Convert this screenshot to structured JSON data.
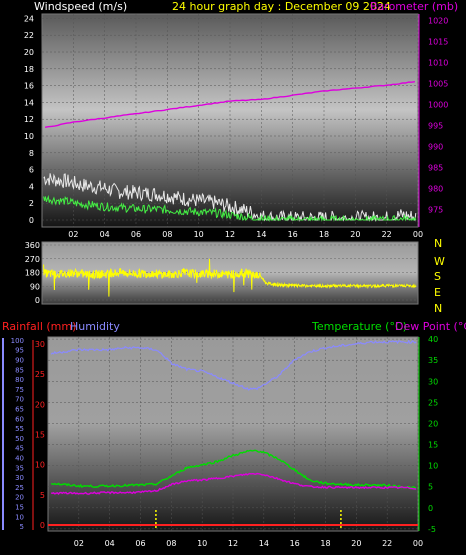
{
  "header": {
    "left_label": "Windspeed (m/s)",
    "title": "24 hour graph day : December 09 2024",
    "right_label": "Barometer (mb)"
  },
  "bottom_header": {
    "rainfall_label": "Rainfall (mm)",
    "humidity_label": "Humidity",
    "temperature_label": "Temperature (°C)",
    "dewpoint_label": "Dew Point (°C)"
  },
  "colors": {
    "background": "#000000",
    "axis_text": "#ffffff",
    "title": "#ffff00",
    "barometer": "#dd00dd",
    "gust": "#e8e8e8",
    "wind": "#44ee44",
    "direction": "#ffff00",
    "rainfall": "#ff2020",
    "humidity": "#8a8aff",
    "temperature": "#00dd00",
    "dewpoint": "#dd00dd",
    "rain_marker": "#ffff00"
  },
  "chart_data": [
    {
      "type": "line",
      "x_ticks": [
        "02",
        "04",
        "06",
        "08",
        "10",
        "12",
        "14",
        "16",
        "18",
        "20",
        "22",
        "00"
      ],
      "xlim": [
        0,
        24
      ],
      "y_left": {
        "label": "Windspeed (m/s)",
        "ticks": [
          0,
          2,
          4,
          6,
          8,
          10,
          12,
          14,
          16,
          18,
          20,
          22,
          24
        ],
        "ylim": [
          0,
          25
        ]
      },
      "y_right": {
        "label": "Barometer (mb)",
        "ticks": [
          975,
          980,
          985,
          990,
          995,
          1000,
          1005,
          1010,
          1015,
          1020
        ],
        "ylim": [
          972.5,
          1022.5
        ]
      },
      "grid": true,
      "series": [
        {
          "name": "Barometer (mb)",
          "axis": "right",
          "x": [
            0.2,
            2,
            4,
            6,
            8,
            10,
            12,
            14,
            16,
            18,
            20,
            22,
            23.9
          ],
          "values": [
            994.5,
            995.8,
            996.8,
            997.8,
            998.8,
            999.8,
            1000.8,
            1001.2,
            1002.2,
            1003.2,
            1003.9,
            1004.6,
            1005.5
          ]
        },
        {
          "axis": "left",
          "x": [
            0.1,
            0.8,
            1.6,
            2.4,
            3.2,
            4,
            4.8,
            5.6,
            6.4,
            7.2,
            8,
            8.8,
            9.6,
            10.4,
            11.2,
            12,
            12.8,
            13.4,
            14,
            15,
            16,
            18,
            20,
            22,
            23,
            23.9
          ],
          "values": [
            5.0,
            4.8,
            4.6,
            4.2,
            4.0,
            3.8,
            3.4,
            3.3,
            3.2,
            3.1,
            2.9,
            2.6,
            2.4,
            2.2,
            2.0,
            1.6,
            1.2,
            0.9,
            0.4,
            0.2,
            0.2,
            0.2,
            0.2,
            0.2,
            0.6,
            0.3
          ]
        },
        {
          "axis": "left",
          "x": [
            0.1,
            0.8,
            1.6,
            2.4,
            3.2,
            4,
            4.8,
            5.6,
            6.4,
            7.2,
            8,
            8.8,
            9.6,
            10.4,
            11.2,
            12,
            12.8,
            13.4,
            14,
            15,
            16,
            18,
            20,
            22,
            23,
            23.9
          ],
          "values": [
            2.6,
            2.4,
            2.2,
            1.9,
            1.8,
            1.6,
            1.5,
            1.4,
            1.3,
            1.3,
            1.2,
            1.1,
            1.0,
            0.9,
            0.8,
            0.6,
            0.4,
            0.2,
            0.1,
            0,
            0,
            0,
            0,
            0,
            0.1,
            0
          ]
        }
      ]
    },
    {
      "type": "line",
      "x_ticks": [
        "02",
        "04",
        "06",
        "08",
        "10",
        "12",
        "14",
        "16",
        "18",
        "20",
        "22",
        "00"
      ],
      "xlim": [
        0,
        24
      ],
      "y_left": {
        "ticks": [
          0,
          90,
          180,
          270,
          360
        ],
        "ylim": [
          0,
          360
        ]
      },
      "y_right_labels": [
        "N",
        "W",
        "S",
        "E",
        "N"
      ],
      "series": [
        {
          "name": "Wind direction",
          "x": [
            0.1,
            1,
            2,
            3,
            4,
            5,
            6,
            7,
            8,
            9,
            10,
            11,
            12,
            12.8,
            13.4,
            14,
            14.3,
            15,
            16,
            17,
            18,
            19,
            20,
            21,
            22,
            23,
            23.9
          ],
          "values": [
            175,
            170,
            178,
            165,
            170,
            180,
            172,
            175,
            165,
            178,
            170,
            172,
            168,
            175,
            170,
            150,
            110,
            100,
            95,
            92,
            90,
            94,
            92,
            90,
            95,
            92,
            93
          ]
        }
      ]
    },
    {
      "type": "line",
      "x_ticks": [
        "02",
        "04",
        "06",
        "08",
        "10",
        "12",
        "14",
        "16",
        "18",
        "20",
        "22",
        "00"
      ],
      "xlim": [
        0,
        24
      ],
      "y_left_rain": {
        "label": "Rainfall (mm)",
        "ticks": [
          0,
          5,
          10,
          15,
          20,
          25,
          30
        ],
        "ylim": [
          -0.5,
          30.5
        ]
      },
      "y_left_humidity": {
        "label": "Humidity",
        "ticks": [
          5,
          10,
          15,
          20,
          25,
          30,
          35,
          40,
          45,
          50,
          55,
          60,
          65,
          70,
          75,
          80,
          85,
          90,
          95,
          100
        ],
        "ylim": [
          2.5,
          101.5
        ]
      },
      "y_right": {
        "label": "Temperature (°C)",
        "ticks": [
          -5,
          0,
          5,
          10,
          15,
          20,
          25,
          30,
          35,
          40
        ],
        "ylim": [
          -5.5,
          40.5
        ]
      },
      "grid": true,
      "rain_markers_x": [
        7,
        19
      ],
      "series": [
        {
          "name": "Humidity",
          "axis": "humidity",
          "x": [
            0.2,
            1,
            2,
            3,
            4,
            5,
            6,
            7,
            7.5,
            8,
            9,
            10,
            11,
            12,
            13,
            13.5,
            14,
            15,
            16,
            17,
            18,
            19,
            20,
            21,
            22,
            23,
            23.9
          ],
          "values": [
            93,
            94,
            95,
            95,
            95,
            96,
            96,
            95,
            92,
            88,
            85,
            84,
            81,
            78,
            75,
            75,
            77,
            82,
            90,
            94,
            96,
            97,
            98,
            99,
            99,
            99,
            99
          ]
        },
        {
          "name": "Temperature (°C)",
          "axis": "right",
          "x": [
            0.2,
            1,
            2,
            3,
            4,
            5,
            6,
            7,
            8,
            9,
            10,
            11,
            12,
            13,
            13.5,
            14,
            15,
            16,
            17,
            18,
            19,
            20,
            21,
            22,
            23,
            23.9
          ],
          "values": [
            5.8,
            5.5,
            5.2,
            5.1,
            5.2,
            5.3,
            5.4,
            5.6,
            7.5,
            9.5,
            10.2,
            11.0,
            12.4,
            13.4,
            13.6,
            13.1,
            11.5,
            9.0,
            6.5,
            5.8,
            5.6,
            5.4,
            5.4,
            5.3,
            5.0,
            4.7
          ]
        },
        {
          "name": "Dew Point (°C)",
          "axis": "right",
          "x": [
            0.2,
            1,
            2,
            3,
            4,
            5,
            6,
            7,
            8,
            9,
            10,
            11,
            12,
            13,
            13.5,
            14,
            15,
            16,
            17,
            18,
            19,
            20,
            21,
            22,
            23,
            23.9
          ],
          "values": [
            3.4,
            3.5,
            3.4,
            3.5,
            3.6,
            3.6,
            3.7,
            4.0,
            5.5,
            6.4,
            6.6,
            7.0,
            7.5,
            8.0,
            8.1,
            7.9,
            6.8,
            5.7,
            5.0,
            4.9,
            4.8,
            4.8,
            4.8,
            4.8,
            4.8,
            4.6
          ]
        },
        {
          "name": "Rainfall (mm)",
          "axis": "rain",
          "x": [
            0,
            24
          ],
          "values": [
            0,
            0
          ]
        }
      ]
    }
  ]
}
